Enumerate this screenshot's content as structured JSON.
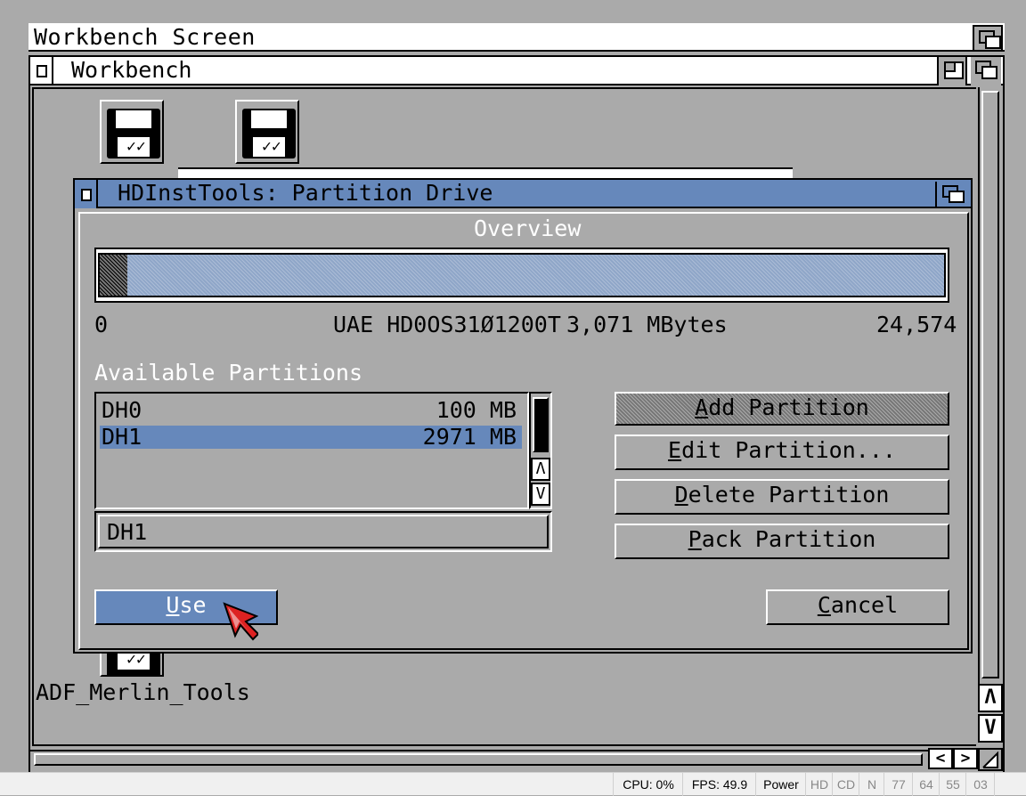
{
  "screen": {
    "title": "Workbench Screen"
  },
  "workbench_window": {
    "title": "Workbench"
  },
  "desktop_icons": [
    {
      "label": "ADF_Merlin_Tools"
    }
  ],
  "dialog": {
    "title": "HDInstTools: Partition Drive",
    "overview_label": "Overview",
    "overview": {
      "start_label": "0",
      "drive_label": "UAE HD0OS310​1200T",
      "drive_name": "UAE HD0OS31Ø1200T",
      "capacity_label": "3,071 MBytes",
      "end_label": "24,574",
      "used_fraction": 0.033
    },
    "partitions_label": "Available Partitions",
    "partitions": [
      {
        "name": "DH0",
        "size": "100 MB",
        "selected": false
      },
      {
        "name": "DH1",
        "size": "2971 MB",
        "selected": true
      }
    ],
    "selected_name": "DH1",
    "buttons": {
      "add_partition": {
        "u": "A",
        "rest": "dd Partition"
      },
      "edit_partition": {
        "u": "E",
        "rest": "dit Partition..."
      },
      "delete_partition": {
        "u": "D",
        "rest": "elete Partition"
      },
      "pack_partition": {
        "u": "P",
        "rest": "ack Partition"
      },
      "use": {
        "u": "U",
        "rest": "se"
      },
      "cancel": {
        "u": "C",
        "rest": "ancel"
      }
    }
  },
  "scroll_arrows": {
    "up": "Λ",
    "down": "V",
    "left": "<",
    "right": ">"
  },
  "status_bar": {
    "cpu": "CPU: 0%",
    "fps": "FPS: 49.9",
    "power": "Power",
    "hd": "HD",
    "cd": "CD",
    "n": "N",
    "track1": "77",
    "track2": "64",
    "track3": "55",
    "track4": "03"
  },
  "colors": {
    "workbench_grey": "#aaaaaa",
    "accent_blue": "#6688bb",
    "pointer_red": "#dd2222"
  }
}
